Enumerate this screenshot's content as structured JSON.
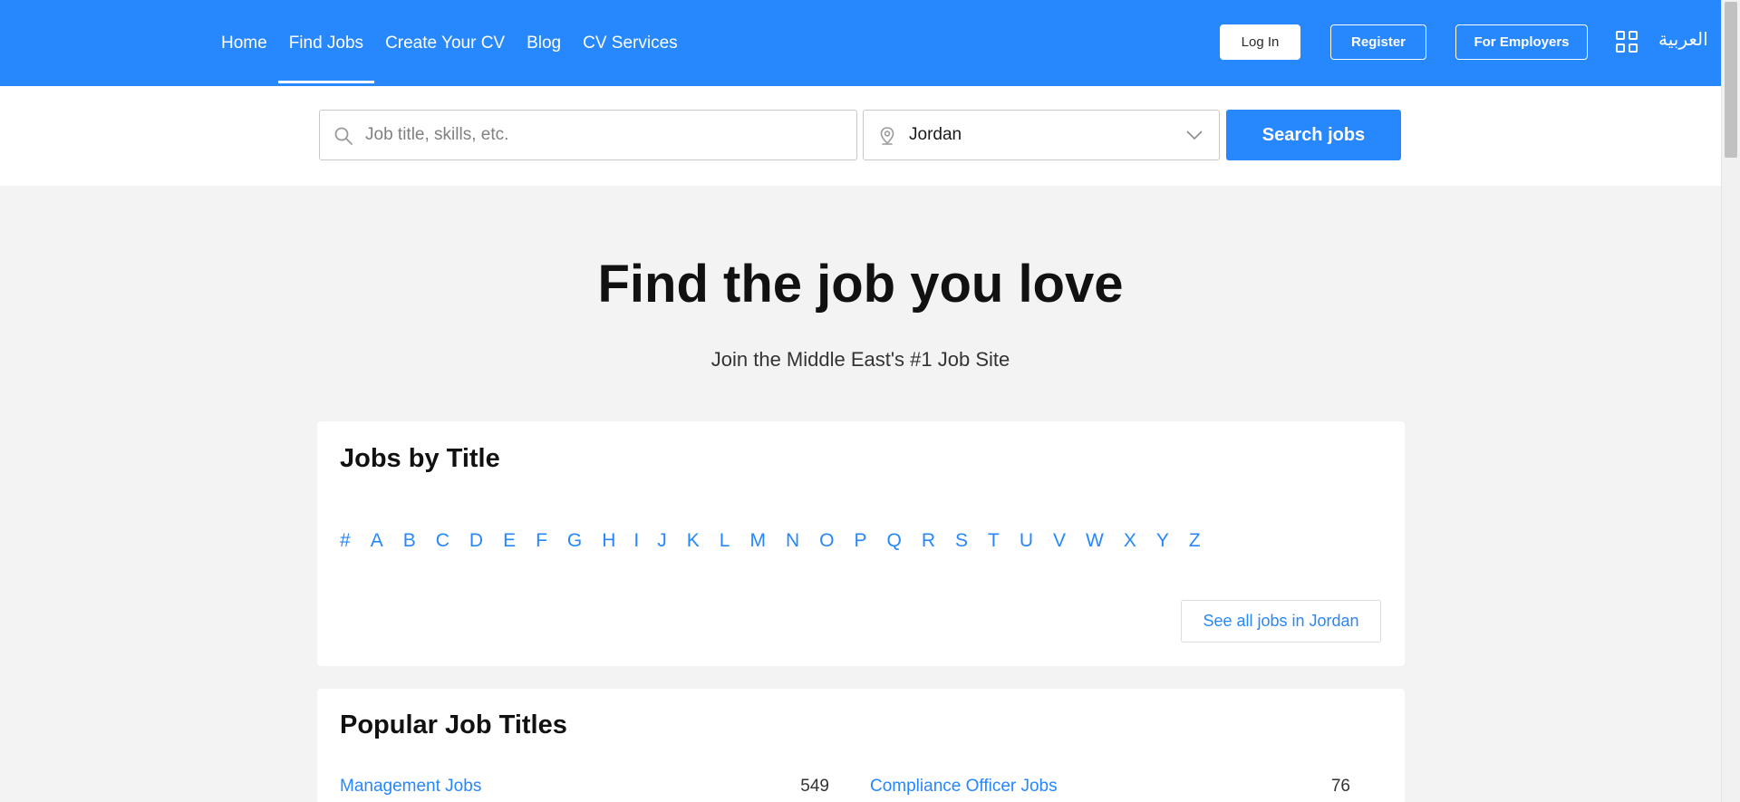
{
  "header": {
    "nav": [
      {
        "label": "Home"
      },
      {
        "label": "Find Jobs"
      },
      {
        "label": "Create Your CV"
      },
      {
        "label": "Blog"
      },
      {
        "label": "CV Services"
      }
    ],
    "active_nav": "Find Jobs",
    "login_label": "Log In",
    "register_label": "Register",
    "employers_label": "For Employers",
    "language_label": "العربية"
  },
  "search": {
    "keyword_placeholder": "Job title, skills, etc.",
    "keyword_value": "",
    "location_value": "Jordan",
    "button_label": "Search jobs"
  },
  "hero": {
    "title": "Find the job you love",
    "subtitle": "Join the Middle East's #1 Job Site"
  },
  "jobs_by_title": {
    "title": "Jobs by Title",
    "letters": [
      "#",
      "A",
      "B",
      "C",
      "D",
      "E",
      "F",
      "G",
      "H",
      "I",
      "J",
      "K",
      "L",
      "M",
      "N",
      "O",
      "P",
      "Q",
      "R",
      "S",
      "T",
      "U",
      "V",
      "W",
      "X",
      "Y",
      "Z"
    ],
    "see_all_label": "See all jobs in Jordan"
  },
  "popular": {
    "title": "Popular Job Titles",
    "items": [
      {
        "label": "Management Jobs",
        "count": "549"
      },
      {
        "label": "Compliance Officer Jobs",
        "count": "76"
      }
    ]
  },
  "colors": {
    "brand": "#2787fd",
    "background": "#f3f3f3"
  }
}
